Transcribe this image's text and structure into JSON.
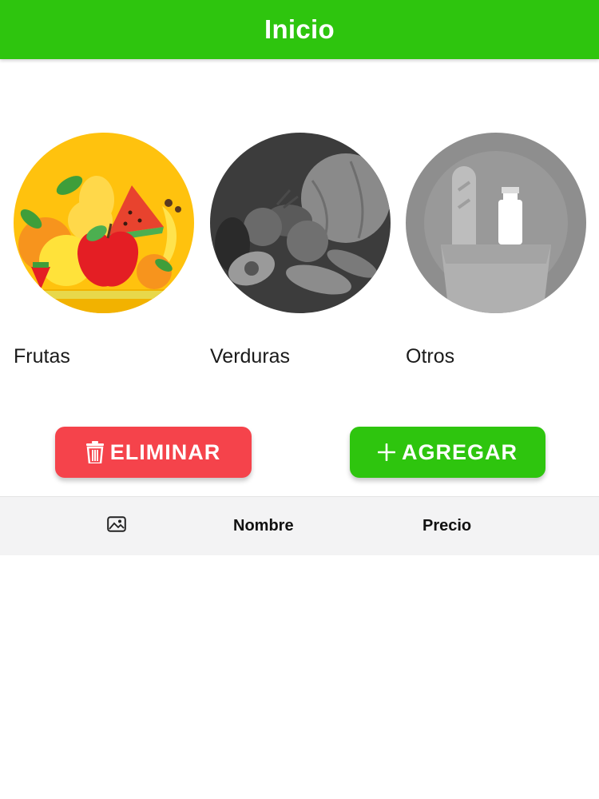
{
  "app_bar": {
    "title": "Inicio",
    "color": "#2ec50e"
  },
  "categories": [
    {
      "label": "Frutas",
      "icon": "fruits-illustration"
    },
    {
      "label": "Verduras",
      "icon": "vegetables-illustration"
    },
    {
      "label": "Otros",
      "icon": "groceries-illustration"
    }
  ],
  "actions": {
    "delete": {
      "label": "ELIMINAR",
      "icon": "trash-icon",
      "color": "#f5434b"
    },
    "add": {
      "label": "AGREGAR",
      "icon": "plus-icon",
      "color": "#2ec50e"
    }
  },
  "table": {
    "columns": [
      {
        "icon": "image-icon"
      },
      {
        "label": "Nombre"
      },
      {
        "label": "Precio"
      }
    ],
    "rows": []
  }
}
